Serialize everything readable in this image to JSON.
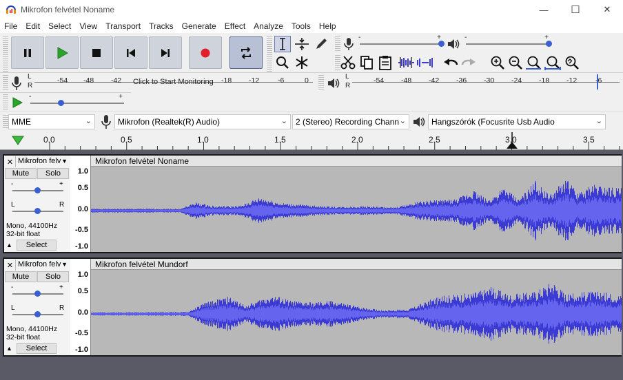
{
  "window": {
    "title": "Mikrofon felvétel Noname",
    "minimize": "—",
    "maximize": "☐",
    "close": "✕"
  },
  "menu": [
    "File",
    "Edit",
    "Select",
    "View",
    "Transport",
    "Tracks",
    "Generate",
    "Effect",
    "Analyze",
    "Tools",
    "Help"
  ],
  "recording_meter": {
    "lr_l": "L",
    "lr_r": "R",
    "ticks": [
      "-54",
      "-48",
      "-42",
      "-18",
      "-12",
      "-6",
      "0"
    ],
    "prompt": "Click to Start Monitoring"
  },
  "playback_meter": {
    "lr_l": "L",
    "lr_r": "R",
    "ticks": [
      "-54",
      "-48",
      "-42",
      "-36",
      "-30",
      "-24",
      "-18",
      "-12",
      "-6"
    ]
  },
  "slider_labels": {
    "minus": "-",
    "plus": "+"
  },
  "devices": {
    "host": "MME",
    "recording_device": "Mikrofon (Realtek(R) Audio)",
    "channels": "2 (Stereo) Recording Chann",
    "playback_device": "Hangszórók (Focusrite Usb Audio"
  },
  "timeline": {
    "labels": [
      "0.0",
      "0.5",
      "1.0",
      "1.5",
      "2.0",
      "2.5",
      "3.0",
      "3.5"
    ]
  },
  "tracks": [
    {
      "name": "Mikrofon felv",
      "title": "Mikrofon felvétel Noname",
      "mute": "Mute",
      "solo": "Solo",
      "info1": "Mono, 44100Hz",
      "info2": "32-bit float",
      "select": "Select",
      "scale": [
        "1.0",
        "0.5",
        "0.0",
        "-0.5",
        "-1.0"
      ],
      "pan_l": "L",
      "pan_r": "R"
    },
    {
      "name": "Mikrofon felv",
      "title": "Mikrofon felvétel Mundorf",
      "mute": "Mute",
      "solo": "Solo",
      "info1": "Mono, 44100Hz",
      "info2": "32-bit float",
      "select": "Select",
      "scale": [
        "1.0",
        "0.5",
        "0.0",
        "-0.5",
        "-1.0"
      ],
      "pan_l": "L",
      "pan_r": "R"
    }
  ],
  "colors": {
    "waveform": "#3b3bd4",
    "waveform_rms": "#6464ee",
    "wave_bg": "#b8b8b8",
    "play_green": "#2aa52a",
    "record_red": "#e0202a"
  }
}
